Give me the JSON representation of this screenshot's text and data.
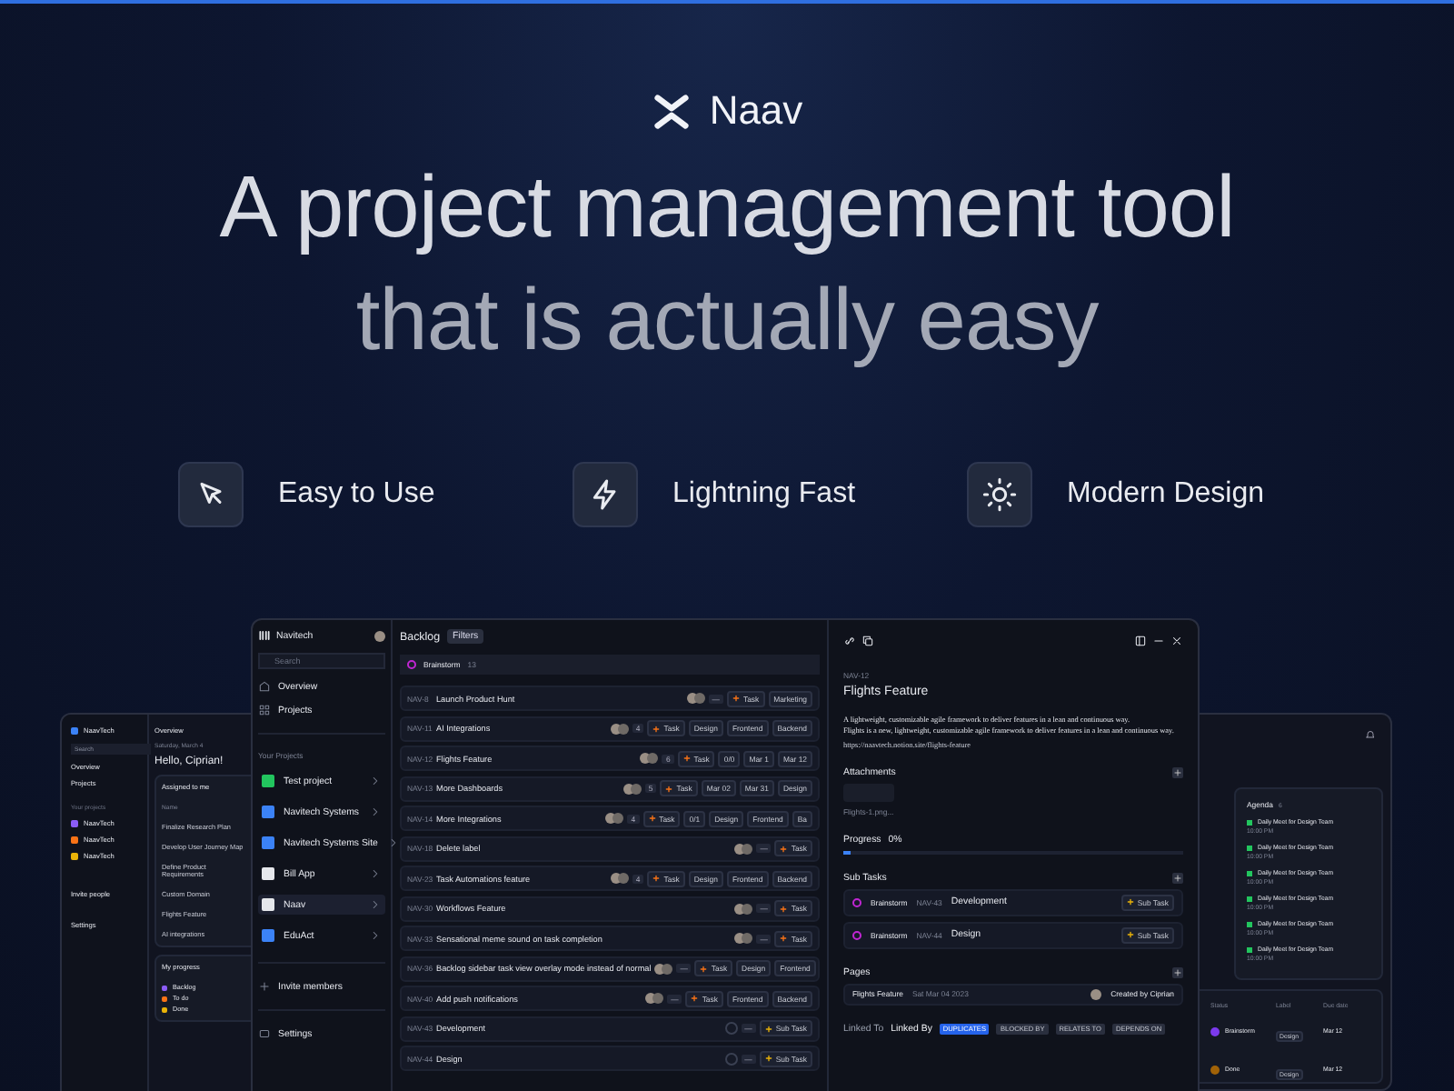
{
  "brand": {
    "name": "Naav"
  },
  "headline": [
    "A project management tool",
    "that is actually easy"
  ],
  "features": [
    {
      "label": "Easy to Use"
    },
    {
      "label": "Lightning Fast"
    },
    {
      "label": "Modern Design"
    }
  ],
  "overview_window": {
    "workspace": "NaavTech",
    "search": {
      "placeholder": "Search"
    },
    "nav": [
      "Overview",
      "Projects"
    ],
    "section": "Your projects",
    "projects": [
      {
        "label": "NaavTech",
        "color": "#8b5cf6"
      },
      {
        "label": "NaavTech",
        "color": "#f97316"
      },
      {
        "label": "NaavTech",
        "color": "#eab308"
      }
    ],
    "invite": "Invite people",
    "settings": "Settings",
    "header": "Overview",
    "date": "Saturday, March 4",
    "greeting": "Hello, Ciprian!",
    "assigned": {
      "title": "Assigned to me",
      "column": "Name",
      "tasks": [
        "Finalize Research Plan",
        "Develop User Journey Map",
        "Define Product Requirements",
        "Custom Domain",
        "Flights Feature",
        "AI integrations"
      ]
    },
    "progress": {
      "title": "My progress",
      "legend": [
        {
          "label": "Backlog",
          "color": "#8b5cf6"
        },
        {
          "label": "To do",
          "color": "#f97316"
        },
        {
          "label": "Done",
          "color": "#eab308"
        }
      ]
    }
  },
  "agenda_window": {
    "title": "Agenda",
    "count": "6",
    "events": [
      {
        "title": "Daily Meet for Design Team",
        "time": "10:00 PM"
      },
      {
        "title": "Daily Meet for Design Team",
        "time": "10:00 PM"
      },
      {
        "title": "Daily Meet for Design Team",
        "time": "10:00 PM"
      },
      {
        "title": "Daily Meet for Design Team",
        "time": "10:00 PM"
      },
      {
        "title": "Daily Meet for Design Team",
        "time": "10:00 PM"
      },
      {
        "title": "Daily Meet for Design Team",
        "time": "10:00 PM"
      }
    ],
    "table": {
      "columns": [
        "Status",
        "Label",
        "Due date"
      ],
      "rows": [
        {
          "status": "Brainstorm",
          "color": "#7c3aed",
          "label": "Design",
          "due": "Mar 12"
        },
        {
          "status": "Done",
          "color": "#a16207",
          "label": "Design",
          "due": "Mar 12"
        }
      ]
    }
  },
  "main_window": {
    "sidebar": {
      "workspace": "Navitech",
      "search": {
        "placeholder": "Search"
      },
      "nav": [
        "Overview",
        "Projects"
      ],
      "section": "Your Projects",
      "projects": [
        {
          "label": "Test project",
          "color": "#22c55e",
          "selected": false
        },
        {
          "label": "Navitech Systems",
          "color": "#3b82f6",
          "selected": false
        },
        {
          "label": "Navitech Systems Site",
          "color": "#3b82f6",
          "selected": false
        },
        {
          "label": "Bill App",
          "color": "#e5e7eb",
          "selected": false
        },
        {
          "label": "Naav",
          "color": "#e5e7eb",
          "selected": true
        },
        {
          "label": "EduAct",
          "color": "#3b82f6",
          "selected": false
        }
      ],
      "invite": "Invite members",
      "settings": "Settings"
    },
    "list": {
      "title": "Backlog",
      "filter": "Filters",
      "group": "Brainstorm",
      "group_count": "13",
      "rows": [
        {
          "id": "NAV-8",
          "title": "Launch Product Hunt",
          "badge": "—",
          "kind": "task",
          "type": "Task",
          "chips": [
            "Marketing"
          ]
        },
        {
          "id": "NAV-11",
          "title": "AI Integrations",
          "badge": "4",
          "kind": "task",
          "type": "Task",
          "chips": [
            "Design",
            "Frontend",
            "Backend"
          ]
        },
        {
          "id": "NAV-12",
          "title": "Flights Feature",
          "badge": "6",
          "kind": "task",
          "type": "Task",
          "chips": [
            "0/0",
            "Mar 1",
            "Mar 12"
          ]
        },
        {
          "id": "NAV-13",
          "title": "More Dashboards",
          "badge": "5",
          "kind": "task",
          "type": "Task",
          "chips": [
            "Mar 02",
            "Mar 31",
            "Design"
          ]
        },
        {
          "id": "NAV-14",
          "title": "More Integrations",
          "badge": "4",
          "kind": "task",
          "type": "Task",
          "chips": [
            "0/1",
            "Design",
            "Frontend",
            "Ba"
          ]
        },
        {
          "id": "NAV-18",
          "title": "Delete label",
          "badge": "—",
          "kind": "task",
          "type": "Task",
          "chips": []
        },
        {
          "id": "NAV-23",
          "title": "Task Automations feature",
          "badge": "4",
          "kind": "task",
          "type": "Task",
          "chips": [
            "Design",
            "Frontend",
            "Backend"
          ]
        },
        {
          "id": "NAV-30",
          "title": "Workflows Feature",
          "badge": "—",
          "kind": "task",
          "type": "Task",
          "chips": []
        },
        {
          "id": "NAV-33",
          "title": "Sensational meme sound on task completion",
          "badge": "—",
          "kind": "task",
          "type": "Task",
          "chips": []
        },
        {
          "id": "NAV-36",
          "title": "Backlog sidebar task view overlay mode instead of normal",
          "badge": "—",
          "kind": "task",
          "type": "Task",
          "chips": [
            "Design",
            "Frontend"
          ]
        },
        {
          "id": "NAV-40",
          "title": "Add push notifications",
          "badge": "—",
          "kind": "task",
          "type": "Task",
          "chips": [
            "Frontend",
            "Backend"
          ]
        },
        {
          "id": "NAV-43",
          "title": "Development",
          "badge": "—",
          "kind": "subtask",
          "type": "Sub Task",
          "chips": []
        },
        {
          "id": "NAV-44",
          "title": "Design",
          "badge": "—",
          "kind": "subtask",
          "type": "Sub Task",
          "chips": []
        }
      ]
    },
    "detail": {
      "id": "NAV-12",
      "title": "Flights Feature",
      "description": [
        "A lightweight, customizable agile framework to deliver features in a lean and continuous way.",
        "Flights is a new, lightweight, customizable agile framework to deliver features in a lean and continuous way."
      ],
      "link": "https://naavtech.notion.site/flights-feature",
      "attachments": {
        "title": "Attachments",
        "file": "Flights-1.png..."
      },
      "progress": {
        "label": "Progress",
        "reading": "0%",
        "level": 0.02
      },
      "subtasks": {
        "title": "Sub Tasks",
        "rows": [
          {
            "status": "Brainstorm",
            "id": "NAV-43",
            "title": "Development",
            "type": "Sub Task"
          },
          {
            "status": "Brainstorm",
            "id": "NAV-44",
            "title": "Design",
            "type": "Sub Task"
          }
        ]
      },
      "pages": {
        "title": "Pages",
        "rows": [
          {
            "title": "Flights Feature",
            "date": "Sat Mar 04 2023",
            "author": "Created by Ciprian"
          }
        ]
      },
      "links": {
        "tabs": [
          {
            "label": "Linked To",
            "selected": false
          },
          {
            "label": "Linked By",
            "selected": true
          }
        ],
        "chips": [
          {
            "label": "DUPLICATES",
            "selected": true
          },
          {
            "label": "BLOCKED BY",
            "selected": false
          },
          {
            "label": "RELATES TO",
            "selected": false
          },
          {
            "label": "DEPENDS ON",
            "selected": false
          }
        ]
      }
    }
  }
}
